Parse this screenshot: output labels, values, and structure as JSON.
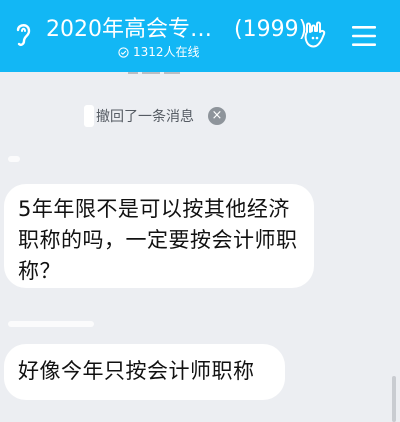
{
  "header": {
    "title": "2020年高会专…",
    "member_count": "(1999)",
    "online_text": "1312人在线",
    "bg_color": "#12b7f5"
  },
  "system_message": {
    "text": "撤回了一条消息"
  },
  "messages": [
    {
      "text": "5年年限不是可以按其他经济职称的吗，一定要按会计师职称？"
    },
    {
      "text": "好像今年只按会计师职称"
    }
  ]
}
